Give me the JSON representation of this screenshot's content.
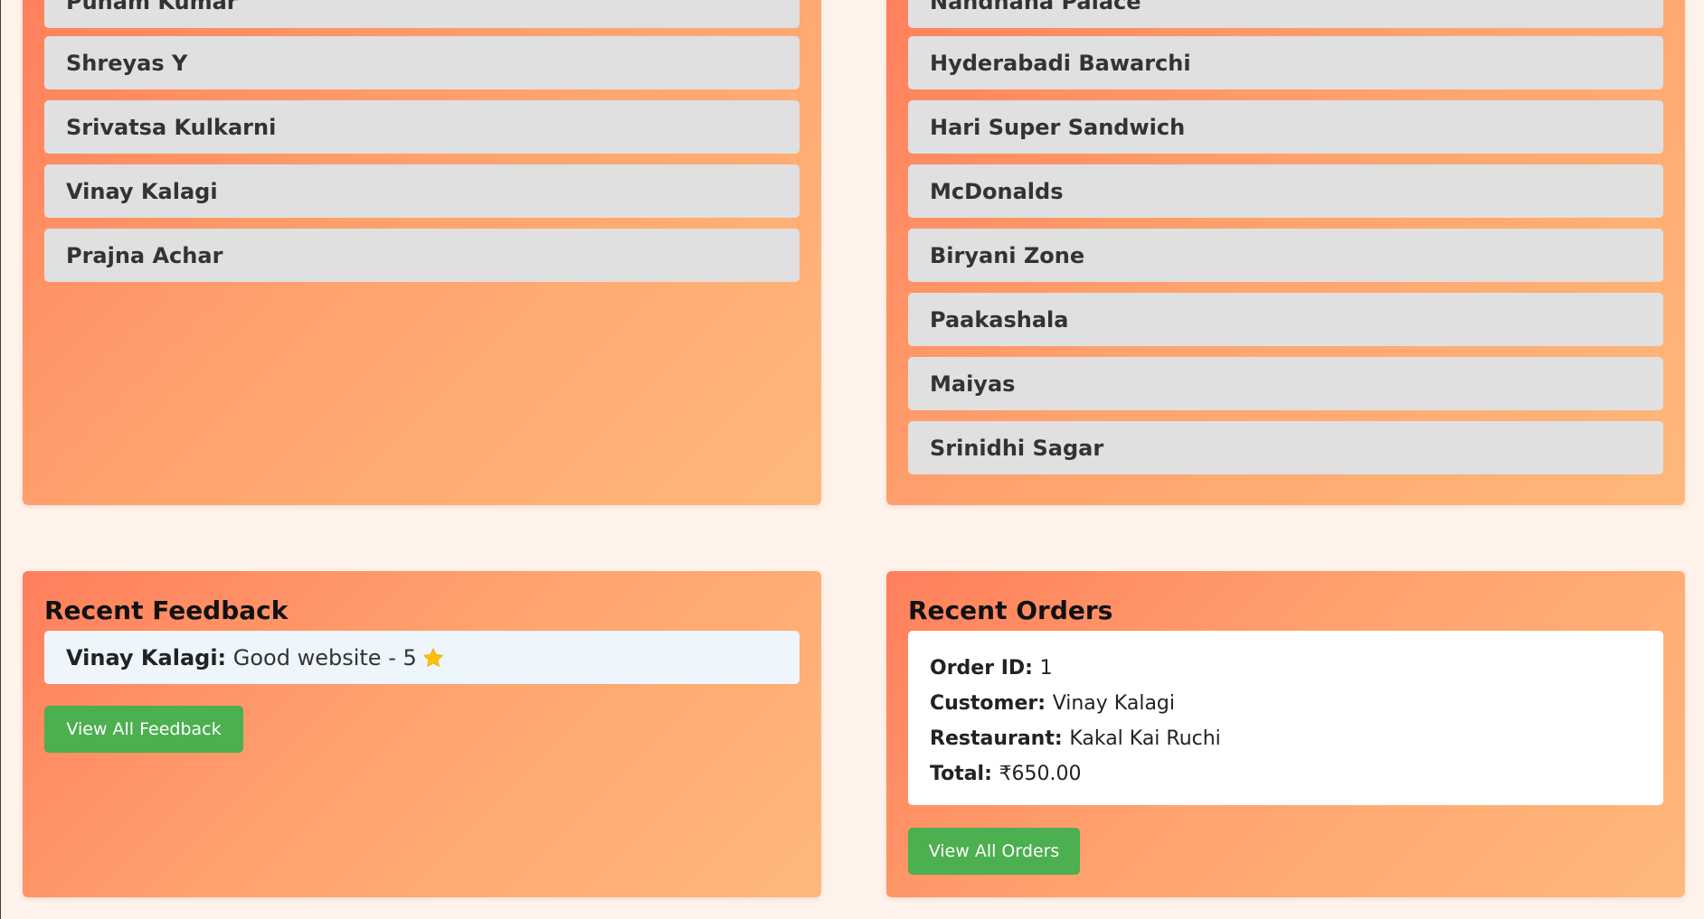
{
  "users": [
    "Punam Kumar",
    "Shreyas Y",
    "Srivatsa Kulkarni",
    "Vinay Kalagi",
    "Prajna Achar"
  ],
  "restaurants": [
    "Nandhana Palace",
    "Hyderabadi Bawarchi",
    "Hari Super Sandwich",
    "McDonalds",
    "Biryani Zone",
    "Paakashala",
    "Maiyas",
    "Srinidhi Sagar"
  ],
  "feedback": {
    "title": "Recent Feedback",
    "item": {
      "name": "Vinay Kalagi:",
      "text": " Good website - 5",
      "icon": "star-icon"
    },
    "button_label": "View All Feedback"
  },
  "orders": {
    "title": "Recent Orders",
    "order_id_label": "Order ID:",
    "order_id": "1",
    "customer_label": "Customer:",
    "customer": "Vinay Kalagi",
    "restaurant_label": "Restaurant:",
    "restaurant": "Kakal Kai Ruchi",
    "total_label": "Total:",
    "total": "₹650.00",
    "button_label": "View All Orders"
  },
  "colors": {
    "page_bg": "#fff2ea",
    "card_gradient_start": "#ff7f5c",
    "card_gradient_end": "#ffb87a",
    "list_item_bg": "#e0e0e0",
    "button_green": "#4caf50",
    "star": "#ffc107"
  }
}
